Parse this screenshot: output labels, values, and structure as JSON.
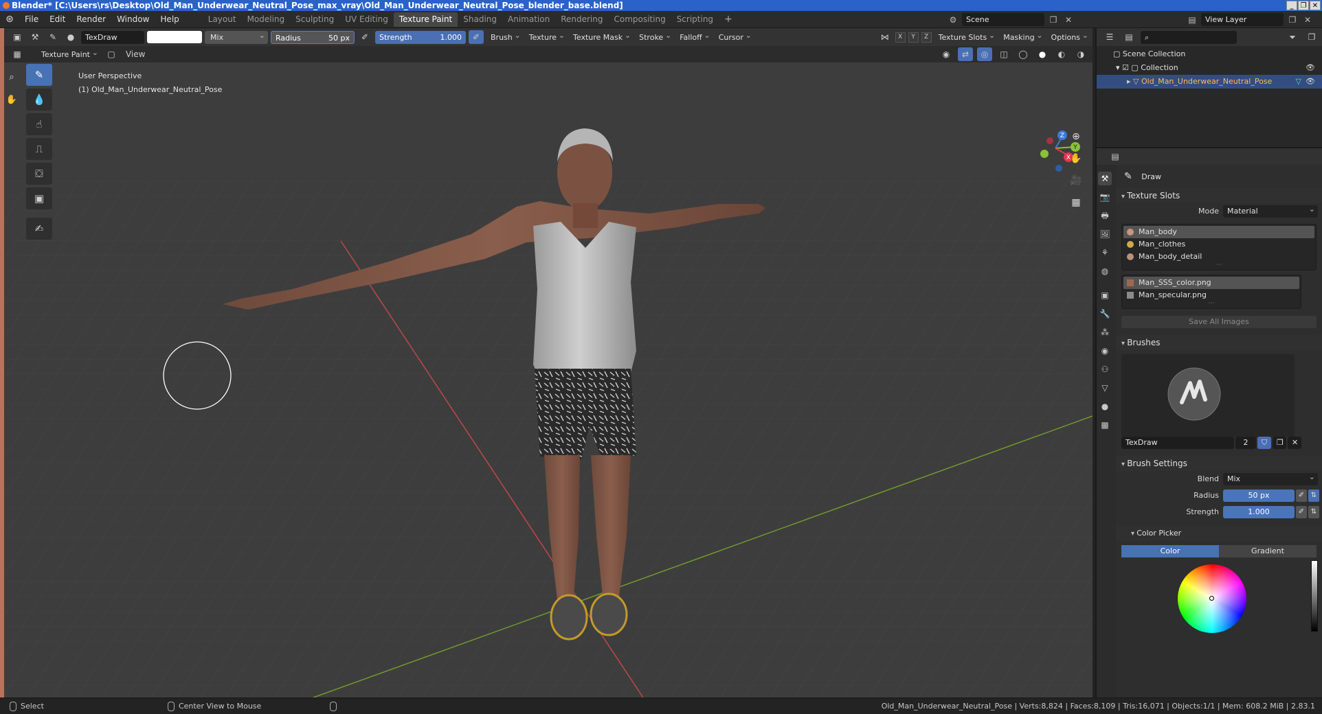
{
  "window": {
    "title": "Blender* [C:\\Users\\rs\\Desktop\\Old_Man_Underwear_Neutral_Pose_max_vray\\Old_Man_Underwear_Neutral_Pose_blender_base.blend]"
  },
  "menu": {
    "items": [
      "File",
      "Edit",
      "Render",
      "Window",
      "Help"
    ]
  },
  "workspaces": {
    "tabs": [
      "Layout",
      "Modeling",
      "Sculpting",
      "UV Editing",
      "Texture Paint",
      "Shading",
      "Animation",
      "Rendering",
      "Compositing",
      "Scripting"
    ],
    "active": "Texture Paint",
    "add_label": "+"
  },
  "scene": {
    "name": "Scene"
  },
  "view_layer": {
    "name": "View Layer"
  },
  "tool_header": {
    "brush_name": "TexDraw",
    "blend": "Mix",
    "radius_label": "Radius",
    "radius_value": "50 px",
    "strength_label": "Strength",
    "strength_value": "1.000",
    "menus": [
      "Brush",
      "Texture",
      "Texture Mask",
      "Stroke",
      "Falloff",
      "Cursor"
    ],
    "axes": [
      "X",
      "Y",
      "Z"
    ],
    "right_menus": [
      "Texture Slots",
      "Masking",
      "Options"
    ]
  },
  "view_header": {
    "mode": "Texture Paint",
    "view_menu": "View"
  },
  "viewport": {
    "perspective": "User Perspective",
    "object_info": "(1) Old_Man_Underwear_Neutral_Pose",
    "gizmo": {
      "z": "Z",
      "y": "Y",
      "x": "X"
    }
  },
  "outliner": {
    "scene_collection": "Scene Collection",
    "collection": "Collection",
    "object": "Old_Man_Underwear_Neutral_Pose"
  },
  "properties": {
    "tool_name": "Draw",
    "texture_slots": {
      "title": "Texture Slots",
      "mode_label": "Mode",
      "mode_value": "Material",
      "materials": [
        "Man_body",
        "Man_clothes",
        "Man_body_detail"
      ],
      "images": [
        "Man_SSS_color.png",
        "Man_specular.png"
      ],
      "save_all": "Save All Images"
    },
    "brushes": {
      "title": "Brushes",
      "brush_name": "TexDraw",
      "users": "2"
    },
    "brush_settings": {
      "title": "Brush Settings",
      "blend_label": "Blend",
      "blend_value": "Mix",
      "radius_label": "Radius",
      "radius_value": "50 px",
      "strength_label": "Strength",
      "strength_value": "1.000"
    },
    "color_picker": {
      "title": "Color Picker",
      "tab_color": "Color",
      "tab_gradient": "Gradient"
    }
  },
  "statusbar": {
    "select": "Select",
    "center_view": "Center View to Mouse",
    "stats": "Old_Man_Underwear_Neutral_Pose | Verts:8,824 | Faces:8,109 | Tris:16,071 | Objects:1/1 | Mem: 608.2 MiB | 2.83.1"
  },
  "colors": {
    "accent": "#4772b3",
    "selected_object": "#ffbb55",
    "title_bar": "#2a62c9"
  }
}
